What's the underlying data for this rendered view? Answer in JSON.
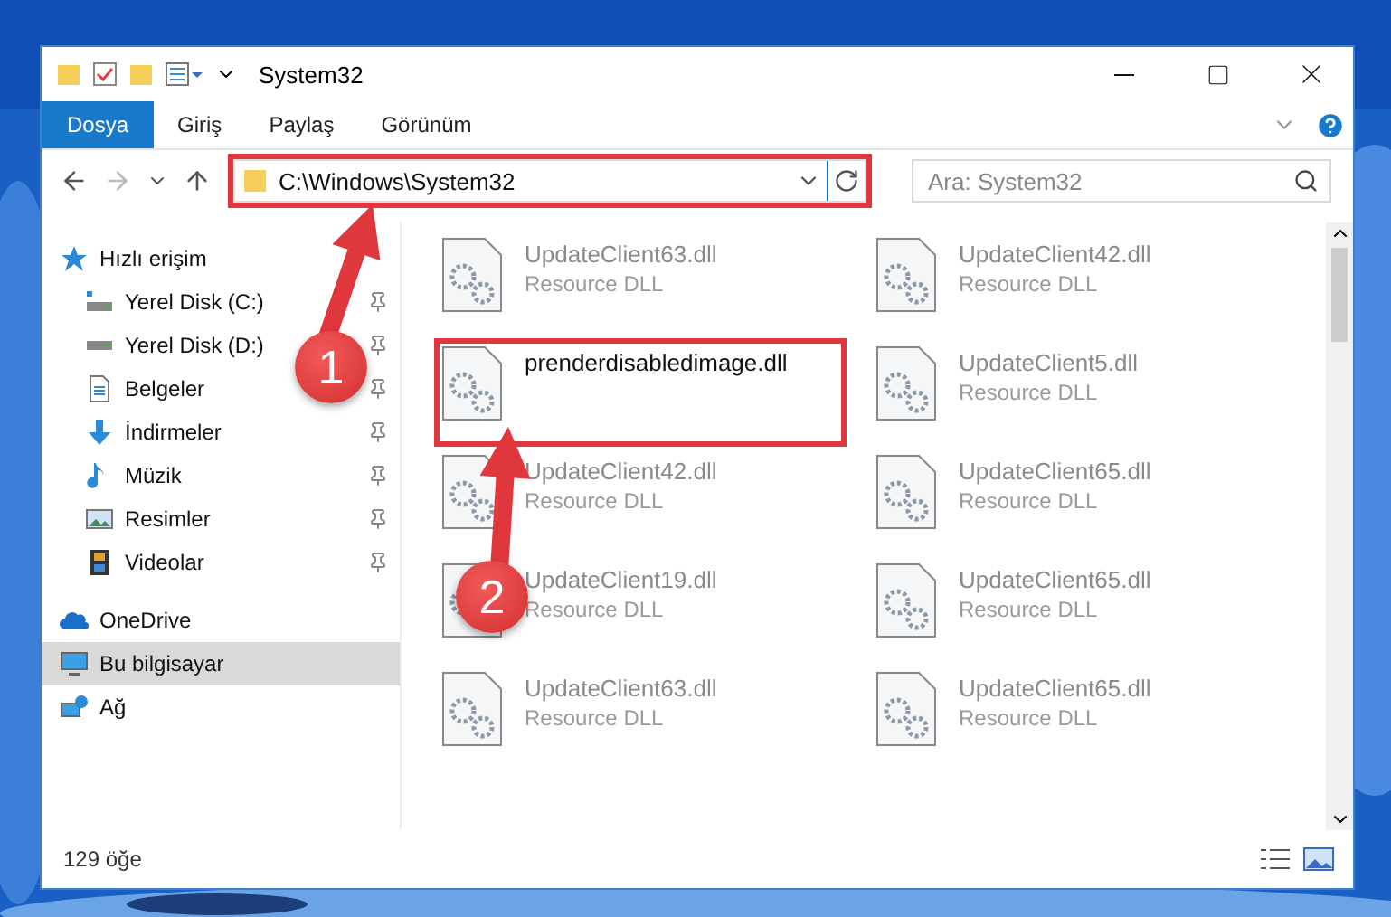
{
  "window": {
    "title": "System32"
  },
  "ribbon": {
    "tabs": [
      {
        "label": "Dosya",
        "selected": true
      },
      {
        "label": "Giriş",
        "selected": false
      },
      {
        "label": "Paylaş",
        "selected": false
      },
      {
        "label": "Görünüm",
        "selected": false
      }
    ]
  },
  "address_bar": {
    "path": "C:\\Windows\\System32",
    "highlighted": true
  },
  "search": {
    "placeholder": "Ara: System32"
  },
  "sidebar": {
    "items": [
      {
        "label": "Hızlı erişim",
        "kind": "star",
        "selected": false,
        "children": [
          {
            "label": "Yerel Disk (C:)",
            "kind": "system-drive",
            "pinned": true,
            "selected": false
          },
          {
            "label": "Yerel Disk (D:)",
            "kind": "drive",
            "pinned": true,
            "selected": false
          },
          {
            "label": "Belgeler",
            "kind": "document",
            "pinned": true,
            "selected": false
          },
          {
            "label": "İndirmeler",
            "kind": "download",
            "pinned": true,
            "selected": false
          },
          {
            "label": "Müzik",
            "kind": "music",
            "pinned": true,
            "selected": false
          },
          {
            "label": "Resimler",
            "kind": "pictures",
            "pinned": true,
            "selected": false
          },
          {
            "label": "Videolar",
            "kind": "video",
            "pinned": true,
            "selected": false
          }
        ]
      },
      {
        "label": "OneDrive",
        "kind": "cloud",
        "selected": false
      },
      {
        "label": "Bu bilgisayar",
        "kind": "computer",
        "selected": true
      },
      {
        "label": "Ağ",
        "kind": "network",
        "selected": false
      }
    ]
  },
  "files": [
    {
      "name": "UpdateClient63.dll",
      "type": "Resource DLL",
      "blurred": true,
      "highlighted": false
    },
    {
      "name": "UpdateClient42.dll",
      "type": "Resource DLL",
      "blurred": true,
      "highlighted": false
    },
    {
      "name": "prenderdisabledimage.dll",
      "blurred": false,
      "highlighted": true
    },
    {
      "name": "UpdateClient5.dll",
      "type": "Resource DLL",
      "blurred": true,
      "highlighted": false
    },
    {
      "name": "UpdateClient42.dll",
      "type": "Resource DLL",
      "blurred": true,
      "highlighted": false
    },
    {
      "name": "UpdateClient65.dll",
      "type": "Resource DLL",
      "blurred": true,
      "highlighted": false
    },
    {
      "name": "UpdateClient19.dll",
      "type": "Resource DLL",
      "blurred": true,
      "highlighted": false
    },
    {
      "name": "UpdateClient65.dll",
      "type": "Resource DLL",
      "blurred": true,
      "highlighted": false
    },
    {
      "name": "UpdateClient63.dll",
      "type": "Resource DLL",
      "blurred": true,
      "highlighted": false
    },
    {
      "name": "UpdateClient65.dll",
      "type": "Resource DLL",
      "blurred": true,
      "highlighted": false
    }
  ],
  "status_bar": {
    "item_count": "129 öğe"
  },
  "annotations": [
    {
      "label": "1"
    },
    {
      "label": "2"
    }
  ]
}
